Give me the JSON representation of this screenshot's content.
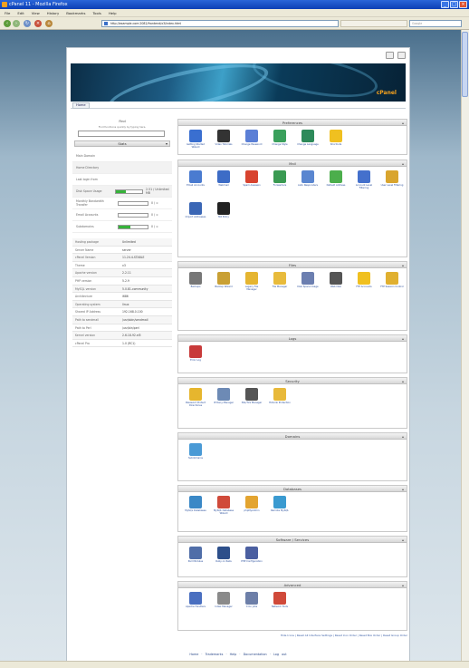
{
  "window": {
    "title": "cPanel 11 - Mozilla Firefox"
  },
  "menu": [
    "File",
    "Edit",
    "View",
    "History",
    "Bookmarks",
    "Tools",
    "Help"
  ],
  "address": {
    "url": "http://example.com:2082/frontend/x3/index.html",
    "search_placeholder": "Google"
  },
  "top_icons": [
    "help-icon",
    "logout-icon"
  ],
  "brand": {
    "logo": "cPanel",
    "accent": "#f6a21d"
  },
  "breadcrumb": "Home",
  "left": {
    "find_label": "Find",
    "find_hint": "Find functions quickly by typing here.",
    "stats_title": "Stats",
    "rows": [
      {
        "label": "Main Domain",
        "shade": false
      },
      {
        "label": "Home Directory",
        "shade": true
      },
      {
        "label": "Last login from",
        "shade": false
      },
      {
        "label": "Disk Space Usage",
        "val": "2.51 / Unlimited MB",
        "fill": 0.4,
        "shade": true
      },
      {
        "label": "Monthly Bandwidth Transfer",
        "val": "0 / ∞",
        "fill": 0,
        "shade": false
      },
      {
        "label": "Email Accounts",
        "val": "0 / ∞",
        "fill": 0,
        "shade": false
      },
      {
        "label": "Subdomains",
        "val": "0 / ∞",
        "fill": 0.4,
        "shade": false
      }
    ],
    "table": [
      {
        "k": "Hosting package",
        "v": "Unlimited"
      },
      {
        "k": "Server Name",
        "v": "server"
      },
      {
        "k": "cPanel Version",
        "v": "11.24.4-STABLE"
      },
      {
        "k": "Theme",
        "v": "x3"
      },
      {
        "k": "Apache version",
        "v": "2.2.11"
      },
      {
        "k": "PHP version",
        "v": "5.2.9"
      },
      {
        "k": "MySQL version",
        "v": "5.0.81-community"
      },
      {
        "k": "Architecture",
        "v": "i686"
      },
      {
        "k": "Operating system",
        "v": "linux"
      },
      {
        "k": "Shared IP Address",
        "v": "192.168.0.100"
      },
      {
        "k": "Path to sendmail",
        "v": "/usr/sbin/sendmail"
      },
      {
        "k": "Path to Perl",
        "v": "/usr/bin/perl"
      },
      {
        "k": "Kernel version",
        "v": "2.6.18-92.el5"
      },
      {
        "k": "cPanel Pro",
        "v": "1.0 (RC1)"
      }
    ]
  },
  "panels": [
    {
      "title": "Preferences",
      "items": [
        {
          "label": "Getting Started Wizard",
          "color": "#3a6fd0"
        },
        {
          "label": "Video Tutorials",
          "color": "#333333"
        },
        {
          "label": "Change Password",
          "color": "#5b7fd6"
        },
        {
          "label": "Change Style",
          "color": "#3aa05c"
        },
        {
          "label": "Change Language",
          "color": "#2d8a5a"
        },
        {
          "label": "Shortcuts",
          "color": "#f0c020"
        }
      ]
    },
    {
      "title": "Mail",
      "items": [
        {
          "label": "Email Accounts",
          "color": "#4a7bd0"
        },
        {
          "label": "Webmail",
          "color": "#3d6cc6"
        },
        {
          "label": "Spam Assassin",
          "color": "#d8432f"
        },
        {
          "label": "Forwarders",
          "color": "#3a9a52"
        },
        {
          "label": "Auto Responders",
          "color": "#5a86d0"
        },
        {
          "label": "Default Address",
          "color": "#4cae4c"
        },
        {
          "label": "Account Level Filtering",
          "color": "#4470cc"
        },
        {
          "label": "User Level Filtering",
          "color": "#d9a52e"
        },
        {
          "label": "Import Addresses",
          "color": "#3a66b5"
        },
        {
          "label": "MX Entry",
          "color": "#222222"
        }
      ]
    },
    {
      "title": "Files",
      "items": [
        {
          "label": "Backups",
          "color": "#777777"
        },
        {
          "label": "Backup Wizard",
          "color": "#c9a034"
        },
        {
          "label": "Legacy File Manager",
          "color": "#e5b531"
        },
        {
          "label": "File Manager",
          "color": "#e8bb3c"
        },
        {
          "label": "Disk Space Usage",
          "color": "#6c7fb0"
        },
        {
          "label": "Web Disk",
          "color": "#555555"
        },
        {
          "label": "FTP Accounts",
          "color": "#f0c020"
        },
        {
          "label": "FTP Session Control",
          "color": "#e0b030"
        }
      ]
    },
    {
      "title": "Logs",
      "items": [
        {
          "label": "Error Log",
          "color": "#c83a3a"
        }
      ]
    },
    {
      "title": "Security",
      "items": [
        {
          "label": "Password Protect Directories",
          "color": "#e6b62e"
        },
        {
          "label": "IP Deny Manager",
          "color": "#6d8ab5"
        },
        {
          "label": "SSL/TLS Manager",
          "color": "#555555"
        },
        {
          "label": "HotLink Protection",
          "color": "#e8b93a"
        }
      ]
    },
    {
      "title": "Domains",
      "items": [
        {
          "label": "Subdomains",
          "color": "#4a9ad6"
        }
      ]
    },
    {
      "title": "Databases",
      "items": [
        {
          "label": "MySQL Databases",
          "color": "#3a88c6"
        },
        {
          "label": "MySQL Database Wizard",
          "color": "#d04a3a"
        },
        {
          "label": "phpMyAdmin",
          "color": "#e3a430"
        },
        {
          "label": "Remote MySQL",
          "color": "#3a9ad0"
        }
      ]
    },
    {
      "title": "Software / Services",
      "items": [
        {
          "label": "Perl Modules",
          "color": "#506ea8"
        },
        {
          "label": "Ruby on Rails",
          "color": "#2d4f8a"
        },
        {
          "label": "PHP Configuration",
          "color": "#4b5fa0"
        }
      ]
    },
    {
      "title": "Advanced",
      "items": [
        {
          "label": "Apache Handlers",
          "color": "#4a6fc0"
        },
        {
          "label": "Index Manager",
          "color": "#8a8a8a"
        },
        {
          "label": "Cron jobs",
          "color": "#6d7fa8"
        },
        {
          "label": "Network Tools",
          "color": "#d04a3a"
        }
      ]
    }
  ],
  "footer_links": "Home · Trademarks · Help · Documentation · Log out",
  "footer_strip": "Hide Icons | Reset All Interface Settings | Reset Icon Order | Reset Box Order | Reset Group Order"
}
